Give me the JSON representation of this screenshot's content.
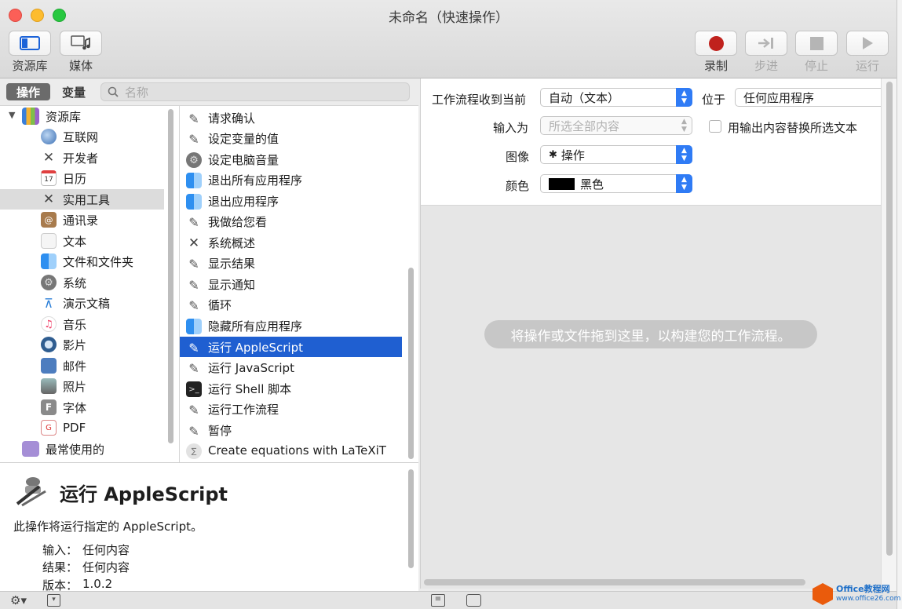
{
  "window": {
    "title": "未命名（快速操作）"
  },
  "toolbar": {
    "library_label": "资源库",
    "media_label": "媒体",
    "record_label": "录制",
    "step_label": "步进",
    "stop_label": "停止",
    "run_label": "运行"
  },
  "tabs": {
    "actions": "操作",
    "variables": "变量"
  },
  "search": {
    "placeholder": "名称"
  },
  "library": {
    "root": "资源库",
    "items": [
      "互联网",
      "开发者",
      "日历",
      "实用工具",
      "通讯录",
      "文本",
      "文件和文件夹",
      "系统",
      "演示文稿",
      "音乐",
      "影片",
      "邮件",
      "照片",
      "字体",
      "PDF"
    ],
    "selected": "实用工具",
    "recent": "最常使用的"
  },
  "actions": {
    "items": [
      "请求确认",
      "设定变量的值",
      "设定电脑音量",
      "退出所有应用程序",
      "退出应用程序",
      "我做给您看",
      "系统概述",
      "显示结果",
      "显示通知",
      "循环",
      "隐藏所有应用程序",
      "运行 AppleScript",
      "运行 JavaScript",
      "运行 Shell 脚本",
      "运行工作流程",
      "暂停",
      "Create equations with LaTeXiT"
    ],
    "selected": "运行 AppleScript"
  },
  "description": {
    "title": "运行 AppleScript",
    "text": "此操作将运行指定的 AppleScript。",
    "input_key": "输入：",
    "input_val": "任何内容",
    "result_key": "结果：",
    "result_val": "任何内容",
    "version_key": "版本：",
    "version_val": "1.0.2"
  },
  "workflow": {
    "receives_label": "工作流程收到当前",
    "receives_value": "自动（文本）",
    "in_label": "位于",
    "in_value": "任何应用程序",
    "input_is_label": "输入为",
    "input_is_value": "所选全部内容",
    "replace_label": "用输出内容替换所选文本",
    "image_label": "图像",
    "image_value": "操作",
    "color_label": "颜色",
    "color_value": "黑色",
    "drop_hint": "将操作或文件拖到这里，以构建您的工作流程。"
  },
  "watermark": {
    "brand": "Office教程网",
    "url": "www.office26.com"
  },
  "colors": {
    "accent": "#2f7bf5",
    "selection": "#1f5fd1",
    "record": "#c0221d"
  }
}
